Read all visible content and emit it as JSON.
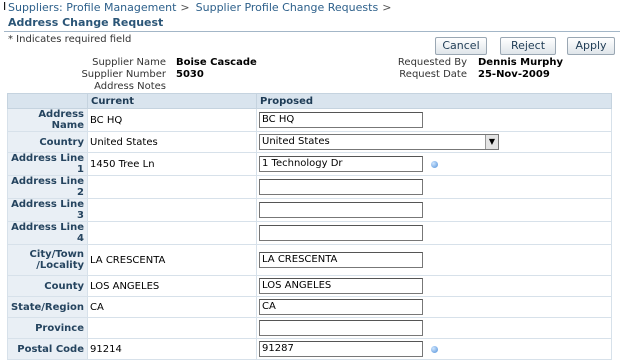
{
  "breadcrumbs": [
    "Suppliers: Profile Management",
    "Supplier Profile Change Requests"
  ],
  "breadcrumb_sep": ">",
  "page_title": "Address Change Request",
  "required_note": "* Indicates required field",
  "buttons": {
    "cancel": "Cancel",
    "reject": "Reject",
    "apply": "Apply"
  },
  "info": {
    "supplier_name_label": "Supplier Name",
    "supplier_name": "Boise Cascade",
    "supplier_number_label": "Supplier Number",
    "supplier_number": "5030",
    "address_notes_label": "Address Notes",
    "requested_by_label": "Requested By",
    "requested_by": "Dennis Murphy",
    "request_date_label": "Request Date",
    "request_date": "25-Nov-2009"
  },
  "table": {
    "col_current": "Current",
    "col_proposed": "Proposed",
    "rows": [
      {
        "label": "Address Name",
        "current": "BC HQ",
        "proposed": "BC HQ"
      },
      {
        "label": "Country",
        "current": "United States",
        "proposed": "United States"
      },
      {
        "label": "Address Line 1",
        "current": "1450 Tree Ln",
        "proposed": "1 Technology Dr"
      },
      {
        "label": "Address Line 2",
        "current": "",
        "proposed": ""
      },
      {
        "label": "Address Line 3",
        "current": "",
        "proposed": ""
      },
      {
        "label": "Address Line 4",
        "current": "",
        "proposed": ""
      },
      {
        "label": "City/Town",
        "label2": "/Locality",
        "current": "LA CRESCENTA",
        "proposed": "LA CRESCENTA"
      },
      {
        "label": "County",
        "current": "LOS ANGELES",
        "proposed": "LOS ANGELES"
      },
      {
        "label": "State/Region",
        "current": "CA",
        "proposed": "CA"
      },
      {
        "label": "Province",
        "current": "",
        "proposed": ""
      },
      {
        "label": "Postal Code",
        "current": "91214",
        "proposed": "91287"
      }
    ]
  }
}
